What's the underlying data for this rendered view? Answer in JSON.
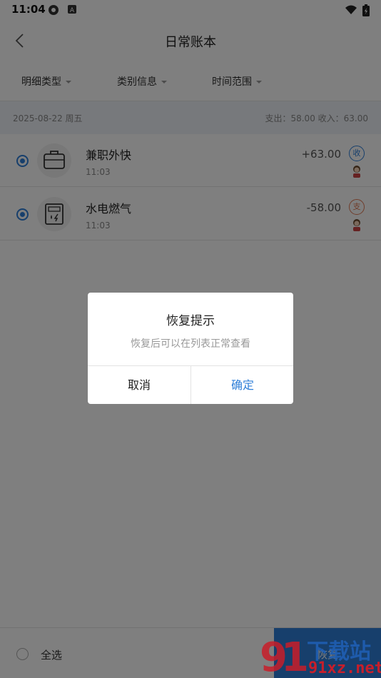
{
  "status_bar": {
    "time": "11:04"
  },
  "header": {
    "title": "日常账本",
    "back_icon": "chevron-left-icon"
  },
  "filters": [
    {
      "label": "明细类型"
    },
    {
      "label": "类别信息"
    },
    {
      "label": "时间范围"
    }
  ],
  "date_group": {
    "date": "2025-08-22 周五",
    "summary": "支出：58.00   收入：63.00"
  },
  "records": [
    {
      "title": "兼职外快",
      "time": "11:03",
      "amount": "+63.00",
      "type": "收",
      "icon": "briefcase-icon",
      "selected": true
    },
    {
      "title": "水电燃气",
      "time": "11:03",
      "amount": "-58.00",
      "type": "支",
      "icon": "utility-meter-icon",
      "selected": true
    }
  ],
  "bottom_bar": {
    "select_all": "全选",
    "restore": "恢复"
  },
  "dialog": {
    "title": "恢复提示",
    "message": "恢复后可以在列表正常查看",
    "cancel": "取消",
    "confirm": "确定"
  },
  "watermark": {
    "brand": "下载站",
    "url": "91xz.net"
  },
  "colors": {
    "accent": "#2f7fd8",
    "expense": "#e07a55",
    "date_bg": "#eef3f8"
  }
}
